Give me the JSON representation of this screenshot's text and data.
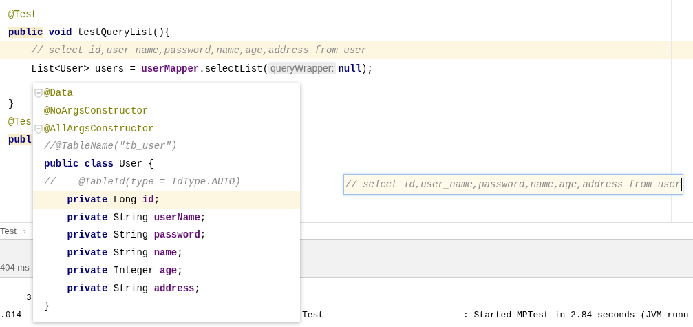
{
  "editor": {
    "lines": [
      {
        "highlighted": false,
        "tokens": [
          {
            "text": "@Test",
            "kind": "annotation"
          }
        ]
      },
      {
        "highlighted": false,
        "tokens": [
          {
            "text": "public",
            "kind": "keyword",
            "marked": true
          },
          {
            "text": " void",
            "kind": "keyword"
          },
          {
            "text": " testQueryList(){",
            "kind": "plain"
          }
        ]
      },
      {
        "highlighted": true,
        "tokens": [
          {
            "text": "    // select id,user_name,password,name,age,address from user",
            "kind": "comment"
          }
        ]
      },
      {
        "highlighted": false,
        "tokens": [
          {
            "text": "    List<User> users = ",
            "kind": "plain"
          },
          {
            "text": "userMapper",
            "kind": "field"
          },
          {
            "text": ".selectList(",
            "kind": "plain"
          },
          {
            "text": "queryWrapper:",
            "kind": "hint"
          },
          {
            "text": "null",
            "kind": "keyword"
          },
          {
            "text": ");",
            "kind": "plain"
          }
        ]
      },
      {
        "highlighted": false
      },
      {
        "highlighted": false,
        "tokens": [
          {
            "text": "}",
            "kind": "plain"
          }
        ]
      },
      {
        "highlighted": false,
        "tokens": [
          {
            "text": "@Tes",
            "kind": "annotation"
          }
        ]
      },
      {
        "highlighted": false,
        "tokens": [
          {
            "text": "publ",
            "kind": "keyword",
            "marked": true
          }
        ]
      }
    ]
  },
  "popup": {
    "lines": [
      {
        "highlighted": false,
        "fold": true,
        "tokens": [
          {
            "text": "@Data",
            "kind": "annotation"
          }
        ]
      },
      {
        "highlighted": false,
        "fold": false,
        "tokens": [
          {
            "text": "@NoArgsConstructor",
            "kind": "annotation"
          }
        ]
      },
      {
        "highlighted": false,
        "fold": true,
        "tokens": [
          {
            "text": "@AllArgsConstructor",
            "kind": "annotation"
          }
        ]
      },
      {
        "highlighted": false,
        "fold": false,
        "tokens": [
          {
            "text": "//@TableName(\"tb_user\")",
            "kind": "comment"
          }
        ]
      },
      {
        "highlighted": false,
        "fold": false,
        "tokens": [
          {
            "text": "public class",
            "kind": "keyword"
          },
          {
            "text": " User {",
            "kind": "plain"
          }
        ]
      },
      {
        "highlighted": false,
        "fold": false,
        "tokens": [
          {
            "text": "//    @TableId(type = IdType.AUTO)",
            "kind": "comment"
          }
        ]
      },
      {
        "highlighted": true,
        "fold": false,
        "tokens": [
          {
            "text": "    private",
            "kind": "keyword"
          },
          {
            "text": " Long ",
            "kind": "plain"
          },
          {
            "text": "id",
            "kind": "field"
          },
          {
            "text": ";",
            "kind": "plain"
          }
        ]
      },
      {
        "highlighted": false,
        "fold": false,
        "tokens": [
          {
            "text": "    private",
            "kind": "keyword"
          },
          {
            "text": " String ",
            "kind": "plain"
          },
          {
            "text": "userName",
            "kind": "field"
          },
          {
            "text": ";",
            "kind": "plain"
          }
        ]
      },
      {
        "highlighted": false,
        "fold": false,
        "tokens": [
          {
            "text": "    private",
            "kind": "keyword"
          },
          {
            "text": " String ",
            "kind": "plain"
          },
          {
            "text": "password",
            "kind": "field"
          },
          {
            "text": ";",
            "kind": "plain"
          }
        ]
      },
      {
        "highlighted": false,
        "fold": false,
        "tokens": [
          {
            "text": "    private",
            "kind": "keyword"
          },
          {
            "text": " String ",
            "kind": "plain"
          },
          {
            "text": "name",
            "kind": "field"
          },
          {
            "text": ";",
            "kind": "plain"
          }
        ]
      },
      {
        "highlighted": false,
        "fold": false,
        "tokens": [
          {
            "text": "    private",
            "kind": "keyword"
          },
          {
            "text": " Integer ",
            "kind": "plain"
          },
          {
            "text": "age",
            "kind": "field"
          },
          {
            "text": ";",
            "kind": "plain"
          }
        ]
      },
      {
        "highlighted": false,
        "fold": false,
        "tokens": [
          {
            "text": "    private",
            "kind": "keyword"
          },
          {
            "text": " String ",
            "kind": "plain"
          },
          {
            "text": "address",
            "kind": "field"
          },
          {
            "text": ";",
            "kind": "plain"
          }
        ]
      },
      {
        "highlighted": false,
        "fold": false,
        "tokens": [
          {
            "text": "}",
            "kind": "plain"
          }
        ]
      }
    ]
  },
  "inline_editor": {
    "value": "// select id,user_name,password,name,age,address from user"
  },
  "breadcrumb": {
    "label": "Test",
    "separator": "›"
  },
  "toolbar": {
    "duration": "404 ms"
  },
  "console": {
    "lines": [
      {
        "columns": [
          "3"
        ]
      },
      {
        "columns": [
          ".014",
          "Test",
          ": Started MPTest in 2.84 seconds (JVM runn"
        ]
      }
    ]
  }
}
